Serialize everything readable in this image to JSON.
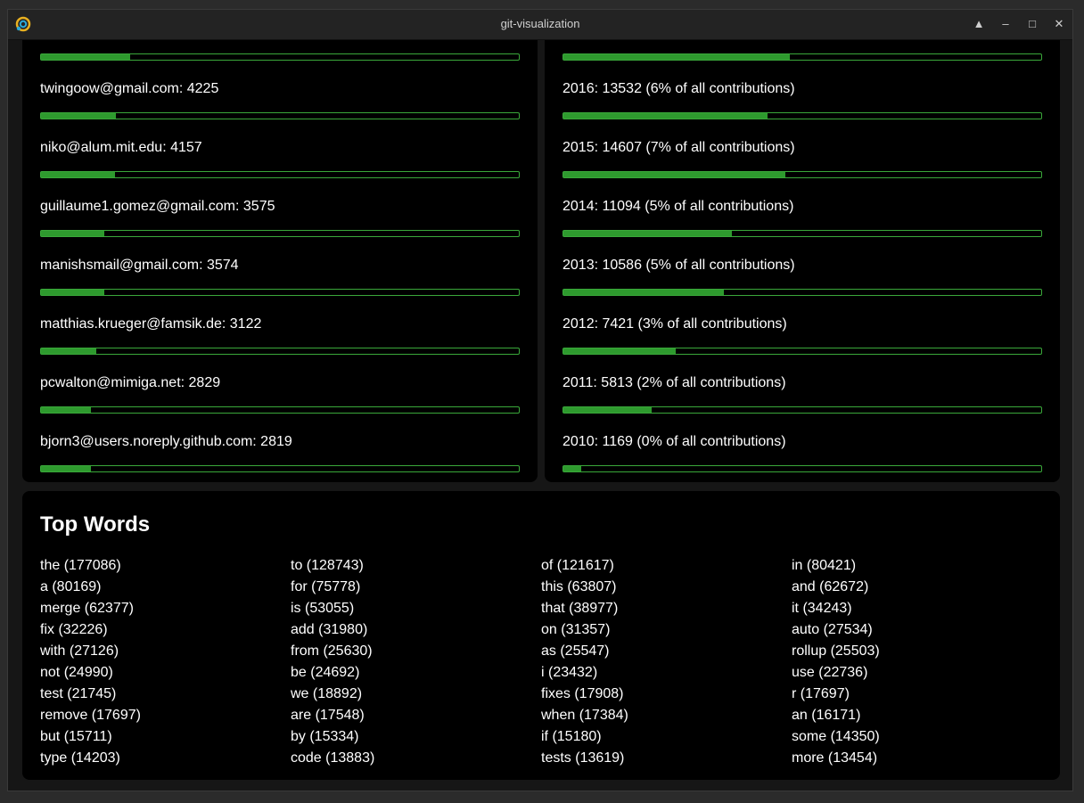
{
  "window": {
    "title": "git-visualization",
    "controls": [
      "▲",
      "–",
      "□",
      "✕"
    ]
  },
  "contributors": [
    {
      "label": "",
      "fraction": 0.186
    },
    {
      "label": "twingoow@gmail.com: 4225",
      "fraction": 0.157
    },
    {
      "label": "niko@alum.mit.edu: 4157",
      "fraction": 0.154
    },
    {
      "label": "guillaume1.gomez@gmail.com: 3575",
      "fraction": 0.133
    },
    {
      "label": "manishsmail@gmail.com: 3574",
      "fraction": 0.133
    },
    {
      "label": "matthias.krueger@famsik.de: 3122",
      "fraction": 0.116
    },
    {
      "label": "pcwalton@mimiga.net: 2829",
      "fraction": 0.105
    },
    {
      "label": "bjorn3@users.noreply.github.com: 2819",
      "fraction": 0.105
    }
  ],
  "years": [
    {
      "label": "",
      "fraction": 0.474
    },
    {
      "label": "2016: 13532 (6% of all contributions)",
      "fraction": 0.428
    },
    {
      "label": "2015: 14607 (7% of all contributions)",
      "fraction": 0.464
    },
    {
      "label": "2014: 11094 (5% of all contributions)",
      "fraction": 0.352
    },
    {
      "label": "2013: 10586 (5% of all contributions)",
      "fraction": 0.336
    },
    {
      "label": "2012: 7421 (3% of all contributions)",
      "fraction": 0.236
    },
    {
      "label": "2011: 5813 (2% of all contributions)",
      "fraction": 0.184
    },
    {
      "label": "2010: 1169 (0% of all contributions)",
      "fraction": 0.037
    }
  ],
  "top_words": {
    "heading": "Top Words",
    "words": [
      "the (177086)",
      "to (128743)",
      "of (121617)",
      "in (80421)",
      "a (80169)",
      "for (75778)",
      "this (63807)",
      "and (62672)",
      "merge (62377)",
      "is (53055)",
      "that (38977)",
      "it (34243)",
      "fix (32226)",
      "add (31980)",
      "on (31357)",
      "auto (27534)",
      "with (27126)",
      "from (25630)",
      "as (25547)",
      "rollup (25503)",
      "not (24990)",
      "be (24692)",
      "i (23432)",
      "use (22736)",
      "test (21745)",
      "we (18892)",
      "fixes (17908)",
      "r (17697)",
      "remove (17697)",
      "are (17548)",
      "when (17384)",
      "an (16171)",
      "but (15711)",
      "by (15334)",
      "if (15180)",
      "some (14350)",
      "type (14203)",
      "code (13883)",
      "tests (13619)",
      "more (13454)"
    ]
  },
  "colors": {
    "bar_fill": "#2e9a2e",
    "bar_border": "#3aa83a",
    "panel_bg": "#000000"
  }
}
